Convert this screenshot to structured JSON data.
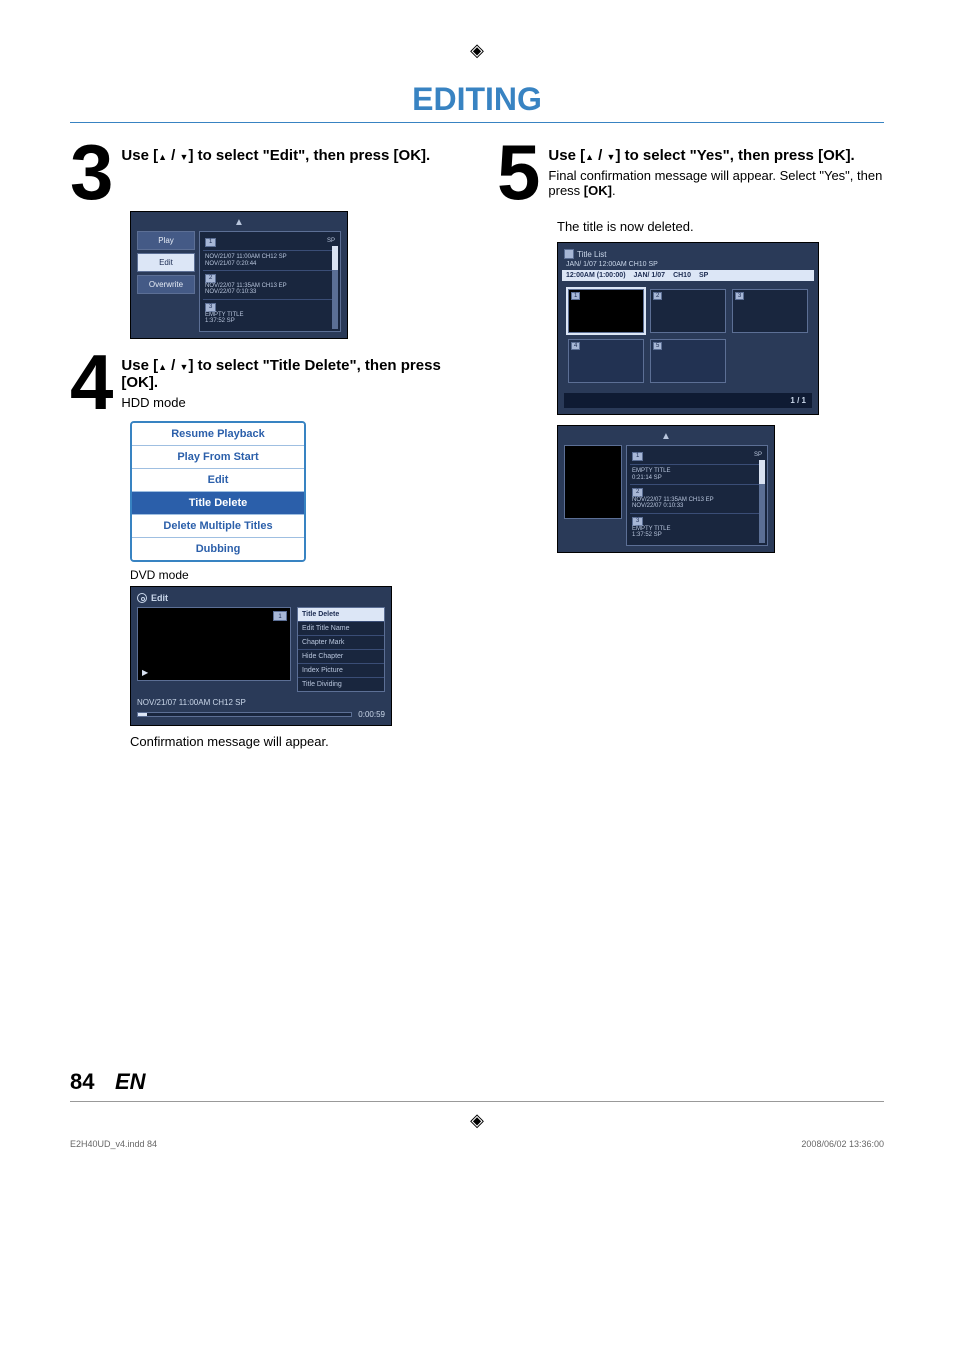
{
  "header": {
    "section_title": "EDITING"
  },
  "step3": {
    "instruction_prefix": "Use [",
    "instruction_mid": " / ",
    "instruction_suffix": "] to select \"Edit\", then press [OK].",
    "panel": {
      "left": [
        "Play",
        "Edit",
        "Overwrite"
      ],
      "sel_index": 1,
      "top": {
        "num": "1",
        "sp": "SP"
      },
      "rows": [
        {
          "num": "1",
          "a": "NOV/21/07 11:00AM CH12 SP",
          "b": "NOV/21/07    0:20:44"
        },
        {
          "num": "2",
          "a": "NOV/22/07 11:35AM CH13 EP",
          "b": "NOV/22/07    0:10:33"
        },
        {
          "num": "3",
          "a": "EMPTY TITLE",
          "b": "1:37:52  SP"
        }
      ]
    }
  },
  "step4": {
    "instruction_prefix": "Use [",
    "instruction_mid": " / ",
    "instruction_suffix": "] to select \"Title Delete\", then press [OK].",
    "hdd_label": "HDD mode",
    "bluelist": [
      "Resume Playback",
      "Play From Start",
      "Edit",
      "Title Delete",
      "Delete Multiple Titles",
      "Dubbing"
    ],
    "bl_sel": 3,
    "dvd_label": "DVD mode",
    "dvd": {
      "title": "Edit",
      "mini": "1",
      "menu": [
        "Title Delete",
        "Edit Title Name",
        "Chapter Mark",
        "Hide Chapter",
        "Index Picture",
        "Title Dividing"
      ],
      "info": "NOV/21/07 11:00AM CH12 SP",
      "time": "0:00:59"
    },
    "confirm": "Confirmation message will appear."
  },
  "step5": {
    "instruction_prefix": "Use [",
    "instruction_mid": " / ",
    "instruction_suffix": "] to select \"Yes\", then press [OK].",
    "sub1": "Final confirmation message will appear. Select \"Yes\", then press ",
    "sub1_bold": "[OK]",
    "sub1_tail": ".",
    "deleted": "The title is now deleted.",
    "tlist": {
      "head": "Title List",
      "meta": "JAN/ 1/07 12:00AM  CH10  SP",
      "bar": [
        "12:00AM (1:00:00)",
        "JAN/  1/07",
        "CH10",
        "SP"
      ],
      "cells": [
        "1",
        "2",
        "3",
        "4",
        "5"
      ],
      "page": "1 / 1"
    },
    "panel2": {
      "top": {
        "num": "1",
        "sp": "SP"
      },
      "rows": [
        {
          "num": "1",
          "a": "EMPTY TITLE",
          "b": "0:21:14  SP"
        },
        {
          "num": "2",
          "a": "NOV/22/07 11:35AM CH13 EP",
          "b": "NOV/22/07    0:10:33"
        },
        {
          "num": "3",
          "a": "EMPTY TITLE",
          "b": "1:37:52  SP"
        }
      ]
    }
  },
  "footer": {
    "page": "84",
    "lang": "EN",
    "file": "E2H40UD_v4.indd   84",
    "date": "2008/06/02   13:36:00"
  }
}
